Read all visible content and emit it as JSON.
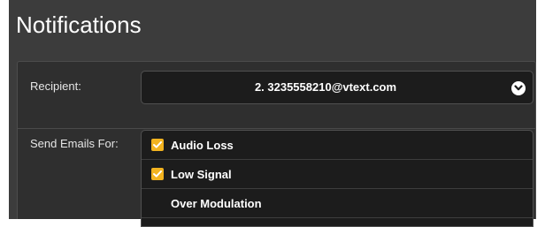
{
  "header": {
    "title": "Notifications"
  },
  "form": {
    "recipient": {
      "label": "Recipient:",
      "selected_value": "2. 3235558210@vtext.com",
      "icon": "chevron-down-icon"
    },
    "send_emails_for": {
      "label": "Send Emails For:",
      "options": [
        {
          "label": "Audio Loss",
          "checked": true
        },
        {
          "label": "Low Signal",
          "checked": true
        },
        {
          "label": "Over Modulation",
          "checked": false
        }
      ]
    }
  },
  "colors": {
    "panel_bg": "#3c3c3c",
    "card_bg": "#2f2f2f",
    "field_bg": "#1c1c1c",
    "checkbox_accent": "#f2b320",
    "text": "#ffffff"
  }
}
